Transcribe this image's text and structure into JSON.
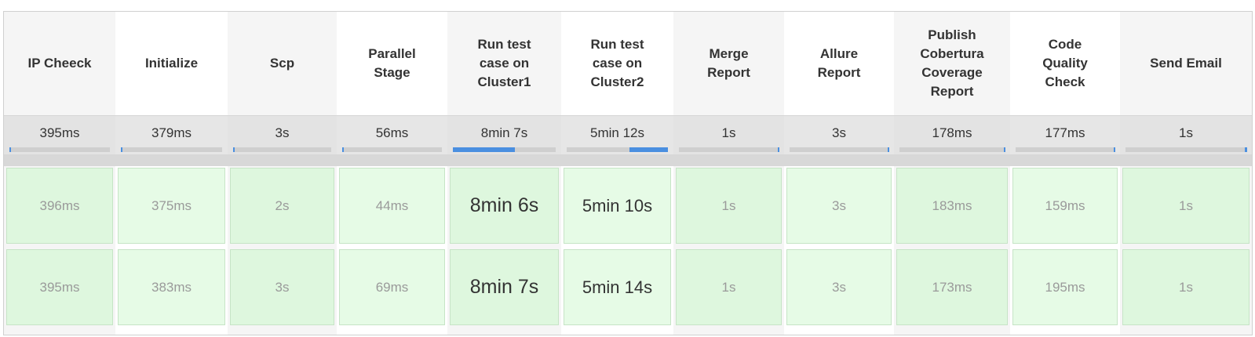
{
  "stages": [
    {
      "name": "IP Cheeck",
      "avg": "395ms",
      "bar": {
        "start": 0,
        "fill": 0.01
      },
      "runs": [
        "396ms",
        "395ms"
      ]
    },
    {
      "name": "Initialize",
      "avg": "379ms",
      "bar": {
        "start": 0,
        "fill": 0.01
      },
      "runs": [
        "375ms",
        "383ms"
      ]
    },
    {
      "name": "Scp",
      "avg": "3s",
      "bar": {
        "start": 0,
        "fill": 0.01
      },
      "runs": [
        "2s",
        "3s"
      ]
    },
    {
      "name": "Parallel\nStage",
      "avg": "56ms",
      "bar": {
        "start": 0,
        "fill": 0.01
      },
      "runs": [
        "44ms",
        "69ms"
      ]
    },
    {
      "name": "Run test\ncase on\nCluster1",
      "avg": "8min 7s",
      "bar": {
        "start": 0,
        "fill": 0.6
      },
      "runs": [
        "8min 6s",
        "8min 7s"
      ],
      "emphasis": "big"
    },
    {
      "name": "Run test\ncase on\nCluster2",
      "avg": "5min 12s",
      "bar": {
        "start": 0.62,
        "fill": 0.38
      },
      "runs": [
        "5min 10s",
        "5min 14s"
      ],
      "emphasis": "mid"
    },
    {
      "name": "Merge\nReport",
      "avg": "1s",
      "bar": {
        "start": 0.99,
        "fill": 0.01
      },
      "runs": [
        "1s",
        "1s"
      ]
    },
    {
      "name": "Allure\nReport",
      "avg": "3s",
      "bar": {
        "start": 0.99,
        "fill": 0.01
      },
      "runs": [
        "3s",
        "3s"
      ]
    },
    {
      "name": "Publish\nCobertura\nCoverage\nReport",
      "avg": "178ms",
      "bar": {
        "start": 0.99,
        "fill": 0.01
      },
      "runs": [
        "183ms",
        "173ms"
      ]
    },
    {
      "name": "Code\nQuality\nCheck",
      "avg": "177ms",
      "bar": {
        "start": 0.99,
        "fill": 0.01
      },
      "runs": [
        "159ms",
        "195ms"
      ]
    },
    {
      "name": "Send Email",
      "avg": "1s",
      "bar": {
        "start": 0.99,
        "fill": 0.01
      },
      "runs": [
        "1s",
        "1s"
      ]
    }
  ],
  "colors": {
    "success_cell": "#def7de",
    "progress_fill": "#4a8fe0",
    "avg_band": "#e6e6e6"
  }
}
